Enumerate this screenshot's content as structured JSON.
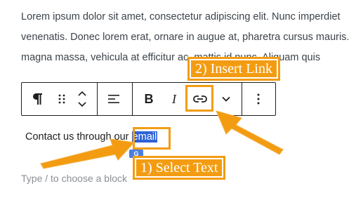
{
  "paragraph": {
    "lines": [
      "Lorem ipsum dolor sit amet, consectetur adipiscing elit. Nunc imperdiet",
      "venenatis. Donec lorem erat, ornare in augue at, pharetra cursus mauris.",
      "magna massa, vehicula at efficitur ac, mattis id nunc. Aliquam quis"
    ]
  },
  "toolbar": {
    "items": [
      {
        "name": "paragraph-icon"
      },
      {
        "name": "drag-handle-icon"
      },
      {
        "name": "move-up-down-icon"
      },
      {
        "name": "align-left-icon"
      },
      {
        "name": "bold-button",
        "label": "B"
      },
      {
        "name": "italic-button",
        "label": "I"
      },
      {
        "name": "link-icon"
      },
      {
        "name": "chevron-down-icon"
      },
      {
        "name": "more-options-icon"
      }
    ],
    "bold_label": "B",
    "italic_label": "I"
  },
  "block": {
    "contact_prefix": "Contact us through our ",
    "selected_word": "email"
  },
  "inserter_badge": "G",
  "placeholder": "Type / to choose a block",
  "annotations": {
    "step1": "1) Select Text",
    "step2": "2) Insert Link",
    "accent_color": "#f39c12",
    "selection_color": "#2f63d6"
  }
}
